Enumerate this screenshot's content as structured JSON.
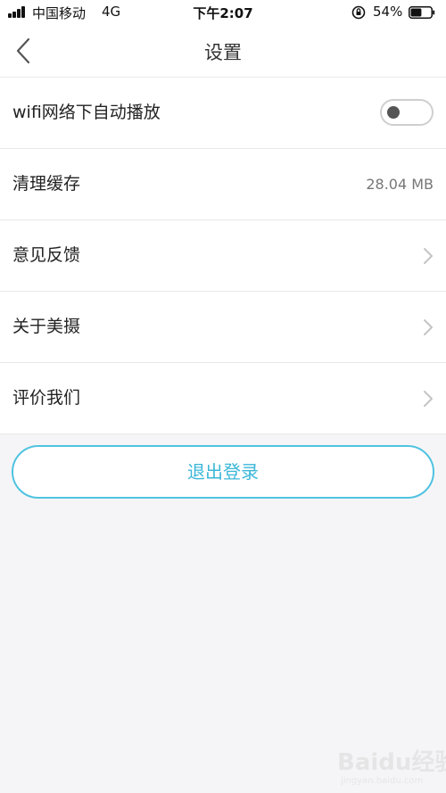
{
  "status_bar": {
    "carrier": "中国移动",
    "network": "4G",
    "time": "下午2:07",
    "battery": "54%",
    "battery_level": 0.54
  },
  "nav": {
    "title": "设置",
    "back_icon": "chevron-left-icon"
  },
  "settings": {
    "items": [
      {
        "label": "wifi网络下自动播放",
        "control": "toggle",
        "toggle_on": false
      },
      {
        "label": "清理缓存",
        "value": "28.04 MB"
      },
      {
        "label": "意见反馈",
        "control": "chevron"
      },
      {
        "label": "关于美摄",
        "control": "chevron"
      },
      {
        "label": "评价我们",
        "control": "chevron"
      }
    ]
  },
  "logout": {
    "label": "退出登录"
  },
  "watermark": {
    "text": "Baidu经验",
    "sub": "jingyan.baidu.com"
  },
  "colors": {
    "accent": "#3bb7d8",
    "accent_border": "#4fc3e0",
    "background": "#f5f5f7",
    "divider": "#e8e8e8"
  }
}
